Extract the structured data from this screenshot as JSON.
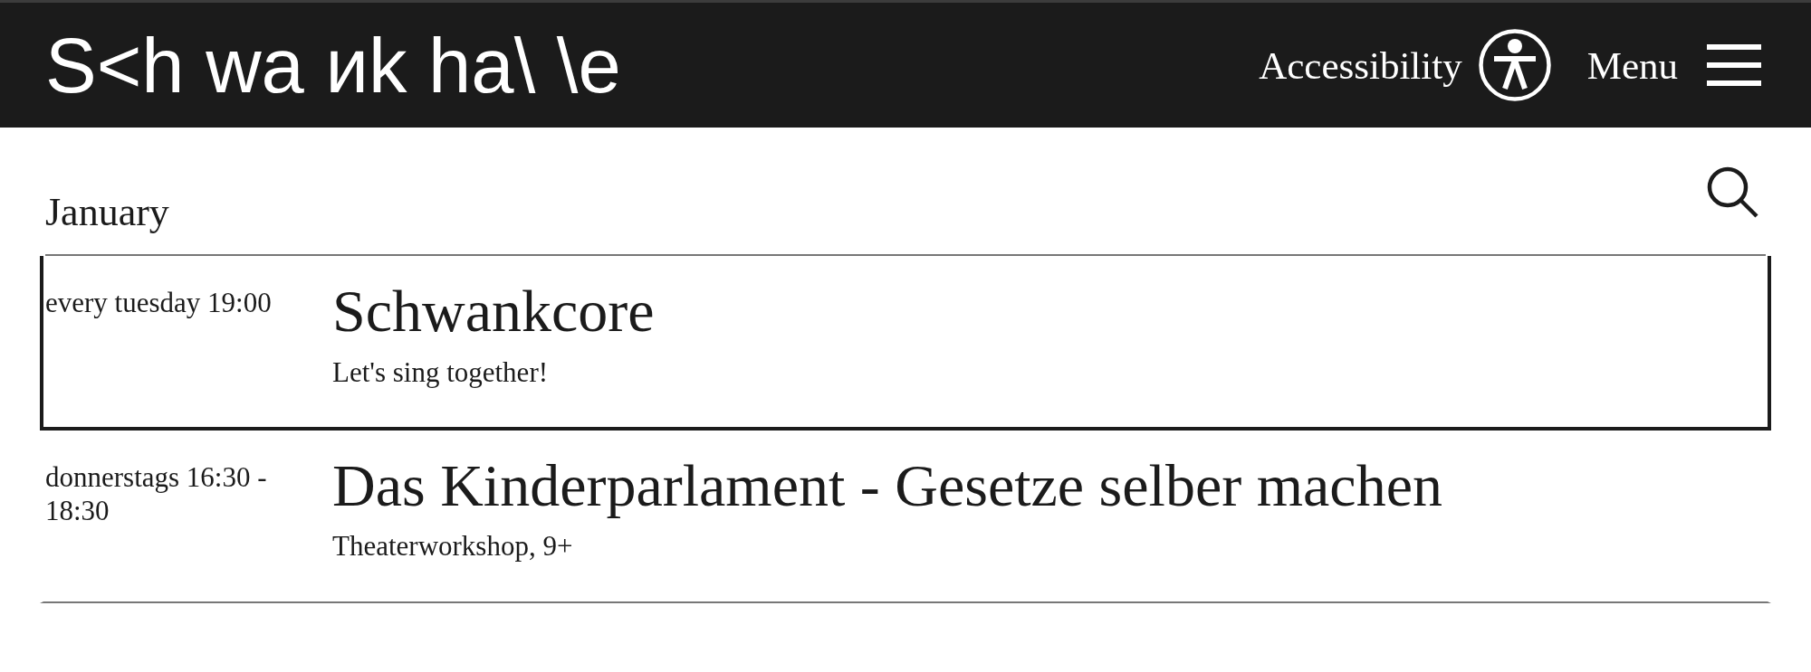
{
  "header": {
    "logo": "S<h wa иk ha\\ \\e",
    "accessibility_label": "Accessibility",
    "menu_label": "Menu"
  },
  "month": "January",
  "events": [
    {
      "when": "every tuesday 19:00",
      "title": "Schwankcore",
      "subtitle": "Let's sing together!",
      "selected": true
    },
    {
      "when": "donnerstags 16:30 - 18:30",
      "title": "Das Kinderparlament - Gesetze selber machen",
      "subtitle": "Theaterworkshop, 9+",
      "selected": false
    }
  ]
}
